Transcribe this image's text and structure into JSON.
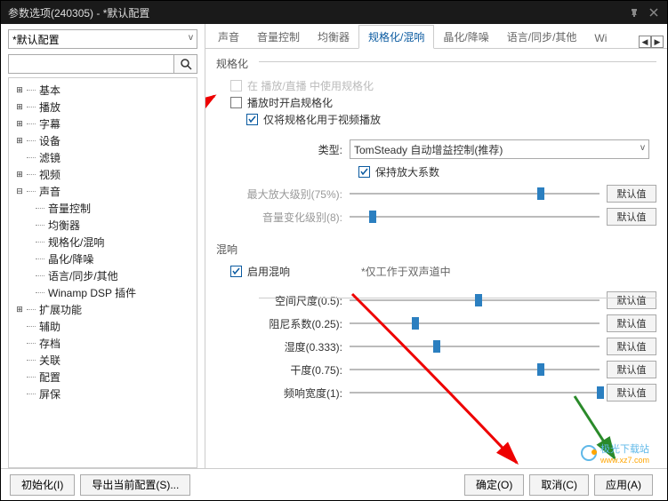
{
  "window": {
    "title": "参数选项(240305) - *默认配置"
  },
  "presetSelect": {
    "value": "*默认配置"
  },
  "search": {
    "placeholder": ""
  },
  "tree": {
    "items": [
      {
        "label": "基本",
        "expandable": true,
        "expanded": false
      },
      {
        "label": "播放",
        "expandable": true,
        "expanded": false
      },
      {
        "label": "字幕",
        "expandable": true,
        "expanded": false
      },
      {
        "label": "设备",
        "expandable": true,
        "expanded": false
      },
      {
        "label": "滤镜",
        "expandable": false
      },
      {
        "label": "视频",
        "expandable": true,
        "expanded": false
      },
      {
        "label": "声音",
        "expandable": true,
        "expanded": true,
        "children": [
          {
            "label": "音量控制"
          },
          {
            "label": "均衡器"
          },
          {
            "label": "规格化/混响"
          },
          {
            "label": "晶化/降噪"
          },
          {
            "label": "语言/同步/其他"
          },
          {
            "label": "Winamp DSP 插件"
          }
        ]
      },
      {
        "label": "扩展功能",
        "expandable": true,
        "expanded": false
      },
      {
        "label": "辅助",
        "expandable": false
      },
      {
        "label": "存档",
        "expandable": false
      },
      {
        "label": "关联",
        "expandable": false
      },
      {
        "label": "配置",
        "expandable": false
      },
      {
        "label": "屏保",
        "expandable": false
      }
    ]
  },
  "tabs": {
    "items": [
      "声音",
      "音量控制",
      "均衡器",
      "规格化/混响",
      "晶化/降噪",
      "语言/同步/其他",
      "Wi"
    ],
    "activeIndex": 3
  },
  "normalize": {
    "title": "规格化",
    "liveLabel": "在 播放/直播 中使用规格化",
    "onPlayLabel": "播放时开启规格化",
    "onlyVideoLabel": "仅将规格化用于视频播放",
    "typeLabel": "类型:",
    "typeValue": "TomSteady 自动增益控制(推荐)",
    "keepCoefLabel": "保持放大系数",
    "maxAmpLabel": "最大放大级别(75%):",
    "volChangeLabel": "音量变化级别(8):"
  },
  "reverb": {
    "title": "混响",
    "enableLabel": "启用混响",
    "note": "*仅工作于双声道中",
    "roomLabel": "空间尺度(0.5):",
    "dampLabel": "阻尼系数(0.25):",
    "wetLabel": "湿度(0.333):",
    "dryLabel": "干度(0.75):",
    "widthLabel": "频响宽度(1):"
  },
  "defaultBtn": "默认值",
  "footer": {
    "init": "初始化(I)",
    "export": "导出当前配置(S)...",
    "ok": "确定(O)",
    "cancel": "取消(C)",
    "apply": "应用(A)"
  },
  "watermark": "极光下载站",
  "watermark_url": "www.xz7.com",
  "chart_data": {
    "type": "bar",
    "note": "slider positions as percentages (visual state)",
    "sliders": [
      {
        "name": "最大放大级别",
        "value": 75,
        "min": 0,
        "max": 100
      },
      {
        "name": "音量变化级别",
        "value": 8,
        "min": 0,
        "max": 100
      },
      {
        "name": "空间尺度",
        "value": 0.5,
        "min": 0,
        "max": 1
      },
      {
        "name": "阻尼系数",
        "value": 0.25,
        "min": 0,
        "max": 1
      },
      {
        "name": "湿度",
        "value": 0.333,
        "min": 0,
        "max": 1
      },
      {
        "name": "干度",
        "value": 0.75,
        "min": 0,
        "max": 1
      },
      {
        "name": "频响宽度",
        "value": 1,
        "min": 0,
        "max": 1
      }
    ]
  }
}
